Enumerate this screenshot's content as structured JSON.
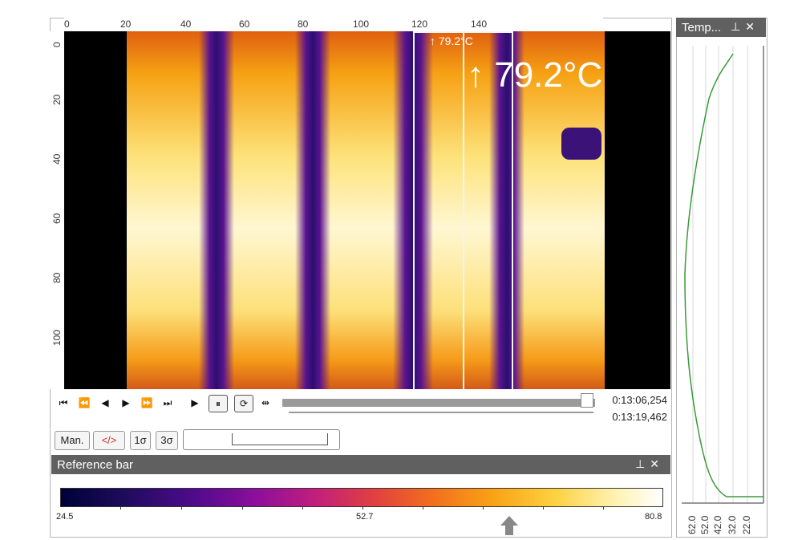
{
  "ruler_top": {
    "labels": [
      "0",
      "20",
      "40",
      "60",
      "80",
      "100",
      "120",
      "140"
    ]
  },
  "ruler_left": {
    "labels": [
      "0",
      "20",
      "40",
      "60",
      "80",
      "100"
    ]
  },
  "roi": {
    "small_label": "↑ 79.2°C",
    "big_label": "↑ 79.2°C"
  },
  "playback": {
    "buttons": [
      "skip-to-start",
      "fast-rewind",
      "step-back",
      "step-forward",
      "fast-forward",
      "skip-to-end",
      "play",
      "pause",
      "loop",
      "trim"
    ],
    "time_current": "0:13:06,254",
    "time_total": "0:13:19,462"
  },
  "palette_buttons": {
    "man": "Man.",
    "code": "</>",
    "sigma1": "1σ",
    "sigma3": "3σ"
  },
  "reference_bar": {
    "title": "Reference bar",
    "min_label": "24.5",
    "mid_label": "52.7",
    "max_label": "80.8"
  },
  "side_panel": {
    "title": "Temp...",
    "axis_labels": [
      "62.0",
      "52.0",
      "42.0",
      "32.0",
      "22.0"
    ]
  },
  "icons": {
    "pin": "pin-icon",
    "close": "close-icon"
  },
  "colors": {
    "panel_header": "#606060",
    "profile_line": "#3a9a3a",
    "roi_border": "#f4f4f4"
  }
}
